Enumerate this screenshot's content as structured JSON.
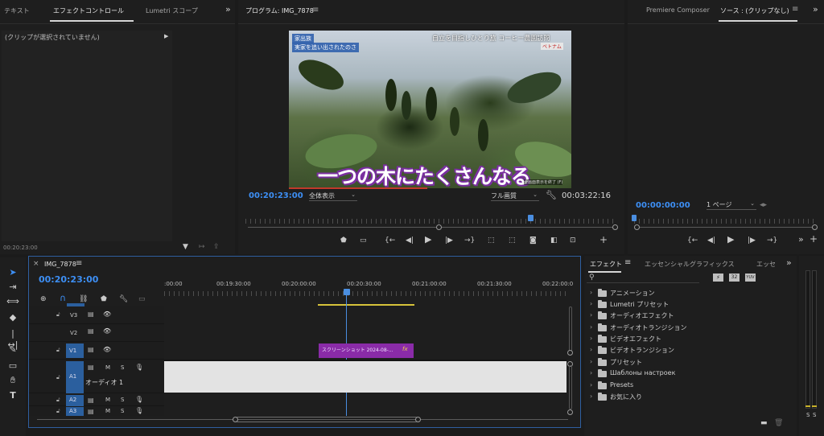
{
  "effect_controls": {
    "tabs": [
      "テキスト",
      "エフェクトコントロール",
      "Lumetri スコープ"
    ],
    "overflow": "»",
    "no_clip": "(クリップが選択されていません)",
    "timecode": "00:20:23:00"
  },
  "program": {
    "title": "プログラム: IMG_7878",
    "menu": "≡",
    "video_caption_tl1": "家出族",
    "video_caption_tl2": "実家を追い出されたのさ",
    "video_caption_tr": "自立を目指しひとり旅 コーヒー農園訪問",
    "video_flag": "ベトナム",
    "video_subtitle": "一つの木にたくさんなる",
    "video_small": "全画面表示を終了 (F)",
    "timecode": "00:20:23:00",
    "zoom_select": "全体表示",
    "quality_select": "フル画質",
    "duration": "00:03:22:16"
  },
  "source": {
    "tabs": [
      "Premiere Composer",
      "ソース : (クリップなし)"
    ],
    "menu": "≡",
    "overflow": "»",
    "timecode": "00:00:00:00",
    "page_select": "1 ページ"
  },
  "timeline": {
    "close": "×",
    "sequence_name": "IMG_7878",
    "menu": "≡",
    "timecode": "00:20:23:00",
    "ruler_labels": [
      ":00:00",
      "00:19:30:00",
      "00:20:00:00",
      "00:20:30:00",
      "00:21:00:00",
      "00:21:30:00",
      "00:22:00:0"
    ],
    "tracks": [
      {
        "id": "V3",
        "label": "V3"
      },
      {
        "id": "V2",
        "label": "V2"
      },
      {
        "id": "V1",
        "label": "V1"
      },
      {
        "id": "A1",
        "label": "A1",
        "name": "オーディオ 1"
      },
      {
        "id": "A2",
        "label": "A2"
      },
      {
        "id": "A3",
        "label": "A3"
      }
    ],
    "mute": "M",
    "solo": "S",
    "clip_label": "スクリーンショット 2024-08-...",
    "clip_fx": "fx",
    "playhead_color": "#4a8ee0",
    "clip_color": "#8a2ba8"
  },
  "effects": {
    "tabs": [
      "エフェクト",
      "エッセンシャルグラフィックス",
      "エッセ"
    ],
    "menu": "≡",
    "overflow": "»",
    "search_placeholder": "",
    "preset_buttons": [
      "32",
      "YUV"
    ],
    "items": [
      "アニメーション",
      "Lumetri プリセット",
      "オーディオエフェクト",
      "オーディオトランジション",
      "ビデオエフェクト",
      "ビデオトランジション",
      "プリセット",
      "Шаблоны настроек",
      "Presets",
      "お気に入り"
    ]
  },
  "meter": {
    "labels": [
      "S",
      "S"
    ]
  },
  "colors": {
    "accent": "#3d8ff5",
    "panel_bg": "#1e1e1e",
    "app_bg": "#1b1b1b"
  }
}
